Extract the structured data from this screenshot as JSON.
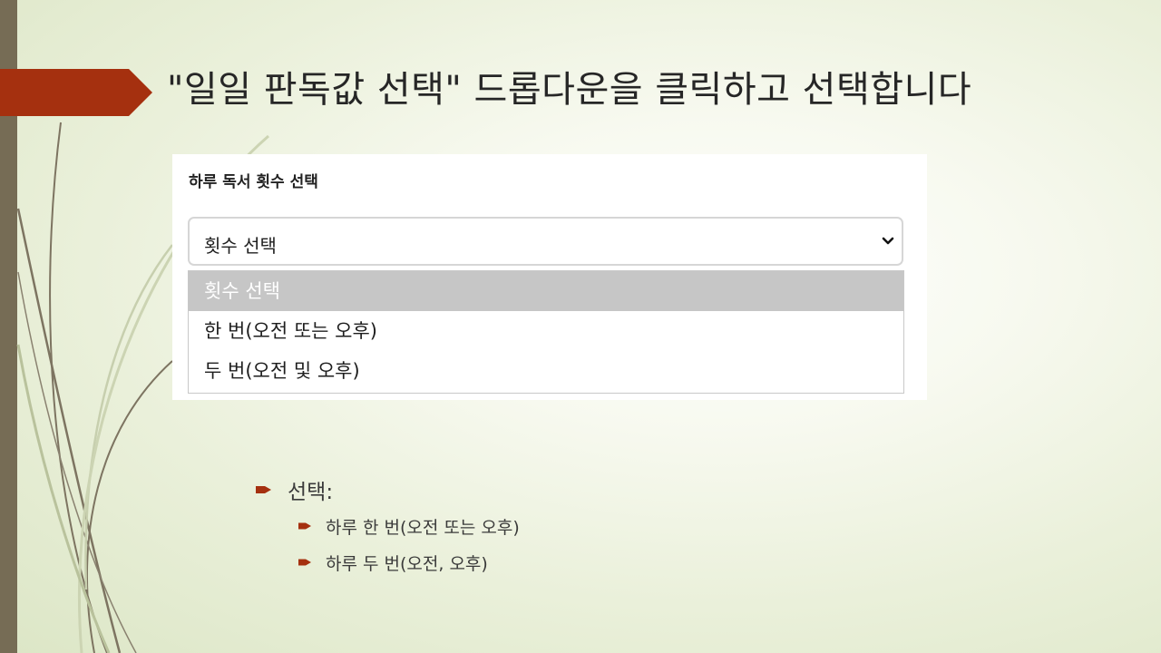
{
  "slide": {
    "title": "\"일일 판독값 선택\" 드롭다운을 클릭하고 선택합니다",
    "colors": {
      "left_bar": "#766c55",
      "accent_arrow": "#a5300f",
      "bullet_marker": "#a5300f",
      "dropdown_selected_bg": "#c6c6c6"
    }
  },
  "screenshot": {
    "label": "하루 독서 횟수 선택",
    "select": {
      "value": "횟수 선택",
      "icon": "chevron-down-icon"
    },
    "options": [
      "횟수 선택",
      "한 번(오전 또는 오후)",
      "두 번(오전 및 오후)"
    ],
    "selected_option_index": 0
  },
  "bullets": {
    "heading": "선택:",
    "items": [
      "하루 한 번(오전 또는 오후)",
      "하루 두 번(오전, 오후)"
    ]
  }
}
